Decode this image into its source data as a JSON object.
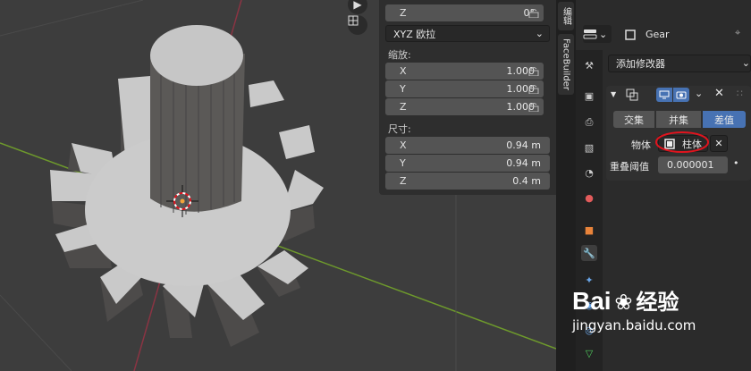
{
  "npanel": {
    "rotation_z": {
      "label": "Z",
      "value": "0°"
    },
    "rotation_mode": "XYZ 欧拉",
    "scale_title": "缩放:",
    "scale": [
      {
        "label": "X",
        "value": "1.000"
      },
      {
        "label": "Y",
        "value": "1.000"
      },
      {
        "label": "Z",
        "value": "1.000"
      }
    ],
    "dimensions_title": "尺寸:",
    "dimensions": [
      {
        "label": "X",
        "value": "0.94 m"
      },
      {
        "label": "Y",
        "value": "0.94 m"
      },
      {
        "label": "Z",
        "value": "0.4 m"
      }
    ]
  },
  "side_tabs": {
    "edit": "编辑",
    "facebuilder": "FaceBuilder"
  },
  "properties": {
    "object_name": "Gear",
    "add_modifier": "添加修改器",
    "boolean_ops": [
      "交集",
      "并集",
      "差值"
    ],
    "active_op": "差值",
    "object_label": "物体",
    "object_value": "柱体",
    "overlap_label": "重叠阈值",
    "overlap_value": "0.000001"
  },
  "watermark": {
    "brand": "Bai",
    "brand2": "经验",
    "url": "jingyan.baidu.com"
  },
  "colors": {
    "accent": "#4772b3",
    "highlight_circle": "#e0141e",
    "axis_x": "#9b3a48",
    "axis_y": "#6e9a2c"
  }
}
